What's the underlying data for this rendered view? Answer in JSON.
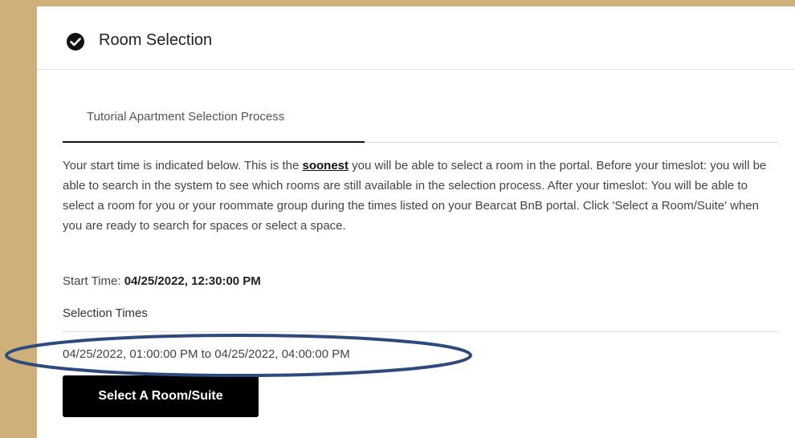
{
  "header": {
    "icon": "check-circle-icon",
    "title": "Room Selection"
  },
  "tabs": [
    {
      "label": "Tutorial Apartment Selection Process",
      "active": true
    }
  ],
  "description": {
    "before": "Your start time is indicated below. This is the ",
    "emphasis": "soonest",
    "after": " you will be able to select a room in the portal. Before your timeslot: you will be able to search in the system to see which rooms are still available in the selection process. After your timeslot: You will be able to select a room for you or your roommate group during the times listed on your Bearcat BnB portal. Click 'Select a Room/Suite' when you are ready to search for spaces or select a space."
  },
  "start_time": {
    "label": "Start Time: ",
    "value": "04/25/2022, 12:30:00 PM"
  },
  "selection_times": {
    "title": "Selection Times",
    "range": "04/25/2022, 01:00:00 PM to 04/25/2022, 04:00:00 PM"
  },
  "actions": {
    "select_button_label": "Select A Room/Suite"
  },
  "colors": {
    "background": "#cfb07a",
    "annotation_oval": "#2d4a7c",
    "button": "#000000"
  }
}
